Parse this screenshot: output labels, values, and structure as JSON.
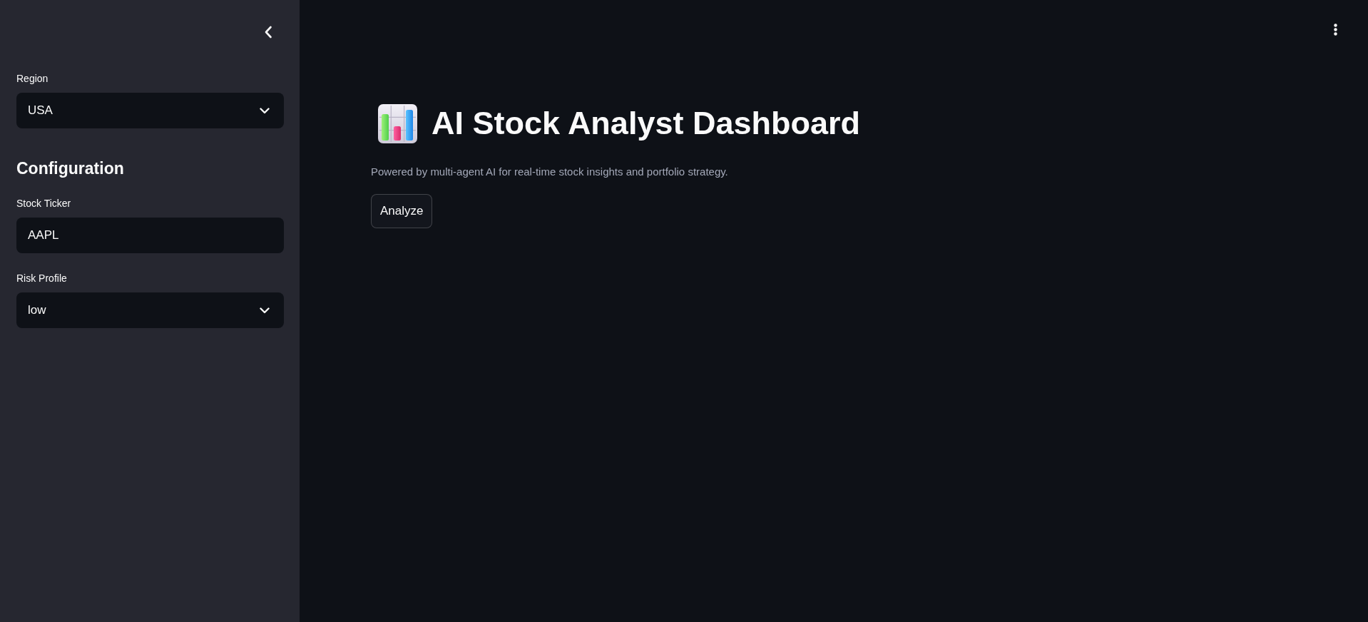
{
  "sidebar": {
    "items": [
      {
        "kind": "select",
        "label": "Region",
        "value": "USA"
      },
      {
        "kind": "heading",
        "text": "Configuration"
      },
      {
        "kind": "text_input",
        "label": "Stock Ticker",
        "value": "AAPL"
      },
      {
        "kind": "select",
        "label": "Risk Profile",
        "value": "low"
      }
    ]
  },
  "main": {
    "title": "AI Stock Analyst Dashboard",
    "subtitle": "Powered by multi-agent AI for real-time stock insights and portfolio strategy.",
    "buttons": [
      {
        "label": "Analyze"
      }
    ]
  }
}
